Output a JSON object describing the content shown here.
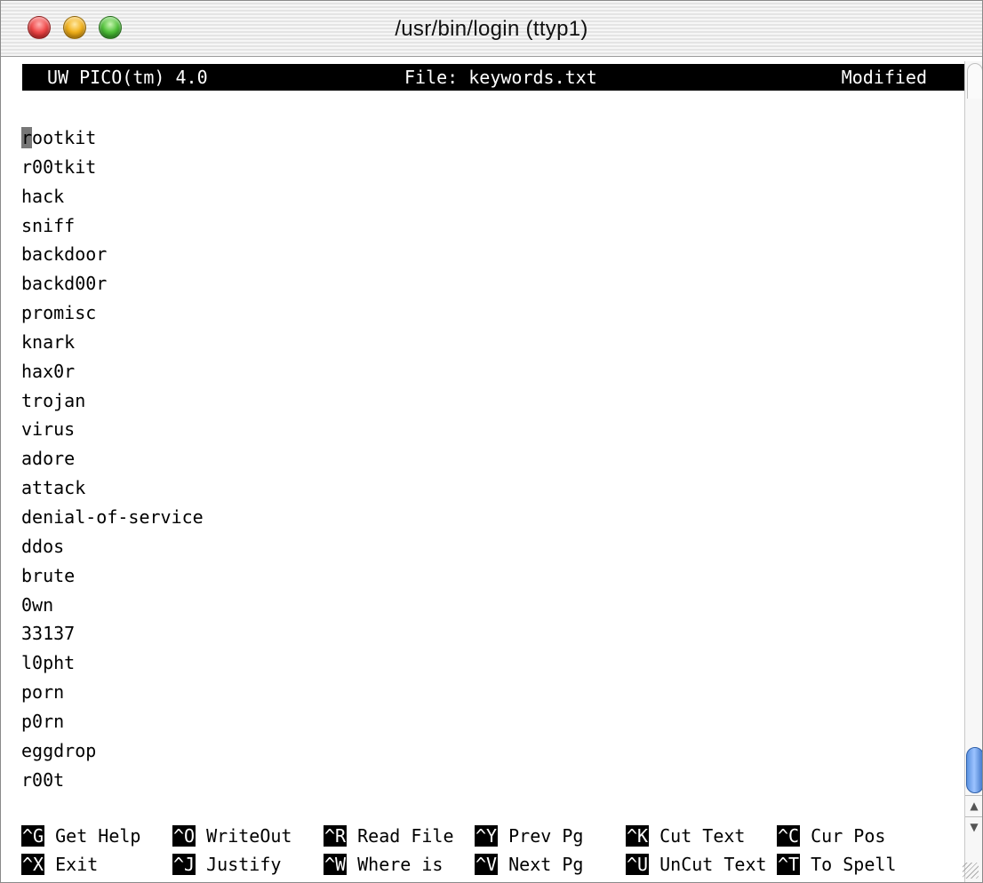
{
  "window": {
    "title": "/usr/bin/login (ttyp1)"
  },
  "editor": {
    "app": "UW PICO(tm) 4.0",
    "file_label": "File: keywords.txt",
    "status": "Modified",
    "cursor_char": "r",
    "first_line_rest": "ootkit",
    "lines": [
      "r00tkit",
      "hack",
      "sniff",
      "backdoor",
      "backd00r",
      "promisc",
      "knark",
      "hax0r",
      "trojan",
      "virus",
      "adore",
      "attack",
      "denial-of-service",
      "ddos",
      "brute",
      "0wn",
      "33137",
      "l0pht",
      "porn",
      "p0rn",
      "eggdrop",
      "r00t"
    ]
  },
  "shortcuts": {
    "row1": [
      {
        "key": "^G",
        "label": "Get Help"
      },
      {
        "key": "^O",
        "label": "WriteOut"
      },
      {
        "key": "^R",
        "label": "Read File"
      },
      {
        "key": "^Y",
        "label": "Prev Pg"
      },
      {
        "key": "^K",
        "label": "Cut Text"
      },
      {
        "key": "^C",
        "label": "Cur Pos"
      }
    ],
    "row2": [
      {
        "key": "^X",
        "label": "Exit"
      },
      {
        "key": "^J",
        "label": "Justify"
      },
      {
        "key": "^W",
        "label": "Where is"
      },
      {
        "key": "^V",
        "label": "Next Pg"
      },
      {
        "key": "^U",
        "label": "UnCut Text"
      },
      {
        "key": "^T",
        "label": "To Spell"
      }
    ]
  },
  "scrollbar": {
    "up_arrow": "▲",
    "down_arrow": "▼"
  }
}
